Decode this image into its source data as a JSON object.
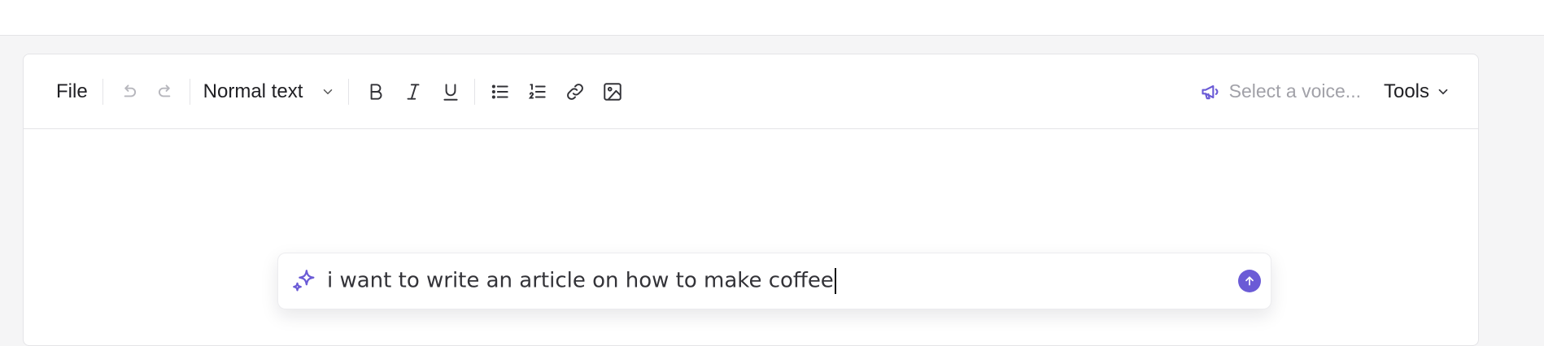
{
  "toolbar": {
    "file_label": "File",
    "style_select": "Normal text",
    "voice_placeholder": "Select a voice...",
    "tools_label": "Tools"
  },
  "prompt": {
    "value": "i want to write an article on how to make coffee"
  },
  "icons": {
    "undo": "undo-icon",
    "redo": "redo-icon",
    "bold": "bold-icon",
    "italic": "italic-icon",
    "underline": "underline-icon",
    "bullet_list": "bullet-list-icon",
    "numbered_list": "numbered-list-icon",
    "link": "link-icon",
    "image": "image-icon",
    "megaphone": "megaphone-icon",
    "sparkle": "sparkle-icon",
    "send": "arrow-up-icon"
  },
  "colors": {
    "accent": "#6b5bd6",
    "border": "#e4e4e7",
    "muted_text": "#a1a1a8"
  }
}
